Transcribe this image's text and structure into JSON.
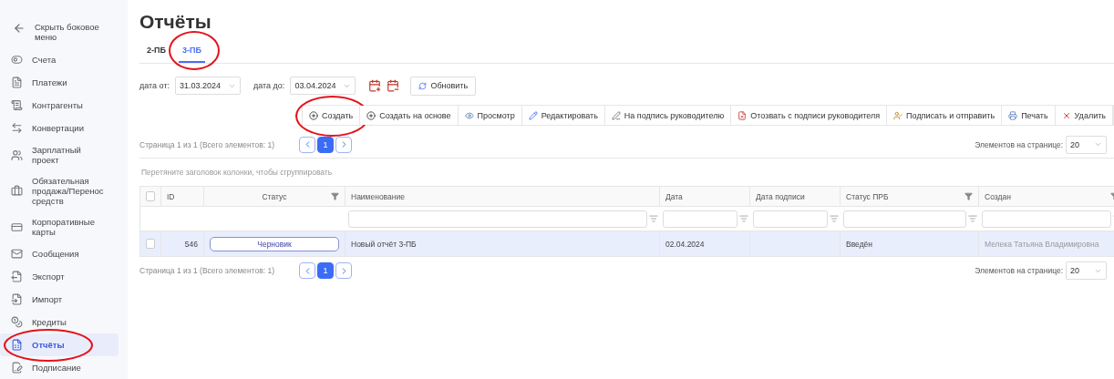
{
  "sidebar": {
    "collapse": {
      "label": "Скрыть боковое меню"
    },
    "items": [
      {
        "label": "Счета",
        "selected": false,
        "circled": false
      },
      {
        "label": "Платежи",
        "selected": false,
        "circled": false
      },
      {
        "label": "Контрагенты",
        "selected": false,
        "circled": false
      },
      {
        "label": "Конвертации",
        "selected": false,
        "circled": false
      },
      {
        "label": "Зарплатный проект",
        "selected": false,
        "circled": false
      },
      {
        "label": "Обязательная продажа/Перенос средств",
        "selected": false,
        "circled": false
      },
      {
        "label": "Корпоративные карты",
        "selected": false,
        "circled": false
      },
      {
        "label": "Сообщения",
        "selected": false,
        "circled": false
      },
      {
        "label": "Экспорт",
        "selected": false,
        "circled": false
      },
      {
        "label": "Импорт",
        "selected": false,
        "circled": false
      },
      {
        "label": "Кредиты",
        "selected": false,
        "circled": false
      },
      {
        "label": "Отчёты",
        "selected": true,
        "circled": true
      },
      {
        "label": "Подписание",
        "selected": false,
        "circled": false
      }
    ]
  },
  "page": {
    "title": "Отчёты"
  },
  "tabs": [
    {
      "label": "2-ПБ",
      "selected": false,
      "circled": false
    },
    {
      "label": "3-ПБ",
      "selected": true,
      "circled": true
    }
  ],
  "filters": {
    "date_from": {
      "label": "дата от:",
      "value": "31.03.2024"
    },
    "date_to": {
      "label": "дата до:",
      "value": "03.04.2024"
    },
    "refresh": {
      "label": "Обновить"
    }
  },
  "toolbar": [
    {
      "label": "Создать",
      "circled": true
    },
    {
      "label": "Создать на основе",
      "circled": false
    },
    {
      "label": "Просмотр",
      "circled": false
    },
    {
      "label": "Редактировать",
      "circled": false
    },
    {
      "label": "На подпись руководителю",
      "circled": false
    },
    {
      "label": "Отозвать с подписи руководителя",
      "circled": false
    },
    {
      "label": "Подписать и отправить",
      "circled": false
    },
    {
      "label": "Печать",
      "circled": false
    },
    {
      "label": "Удалить",
      "circled": false
    }
  ],
  "pager_top": {
    "summary": "Страница 1 из 1 (Всего элементов: 1)",
    "pages": [
      {
        "label": "1",
        "selected": true
      }
    ],
    "page_size_label": "Элементов на странице:",
    "page_size": "20"
  },
  "group_panel": {
    "hint": "Перетяните заголовок колонки, чтобы сгруппировать"
  },
  "table": {
    "select_all_checked": false,
    "columns": [
      {
        "label": "ID",
        "header_filter": false,
        "filter_field": false
      },
      {
        "label": "Статус",
        "header_filter": true,
        "filter_field": false
      },
      {
        "label": "Наименование",
        "header_filter": false,
        "filter_field": true
      },
      {
        "label": "Дата",
        "header_filter": false,
        "filter_field": true
      },
      {
        "label": "Дата подписи",
        "header_filter": false,
        "filter_field": true
      },
      {
        "label": "Статус ПРБ",
        "header_filter": true,
        "filter_field": true
      },
      {
        "label": "Создан",
        "header_filter": true,
        "filter_field": true
      }
    ],
    "rows": [
      {
        "selected": true,
        "checked": false,
        "id": "546",
        "status": "Черновик",
        "name": "Новый отчёт 3-ПБ",
        "date": "02.04.2024",
        "prb_status": "Введён",
        "created_by": "Мелека Татьяна Владимировна"
      }
    ]
  },
  "pager_bottom": {
    "summary": "Страница 1 из 1 (Всего элементов: 1)",
    "pages": [
      {
        "label": "1",
        "selected": true
      }
    ],
    "page_size_label": "Элементов на странице:",
    "page_size": "20"
  }
}
